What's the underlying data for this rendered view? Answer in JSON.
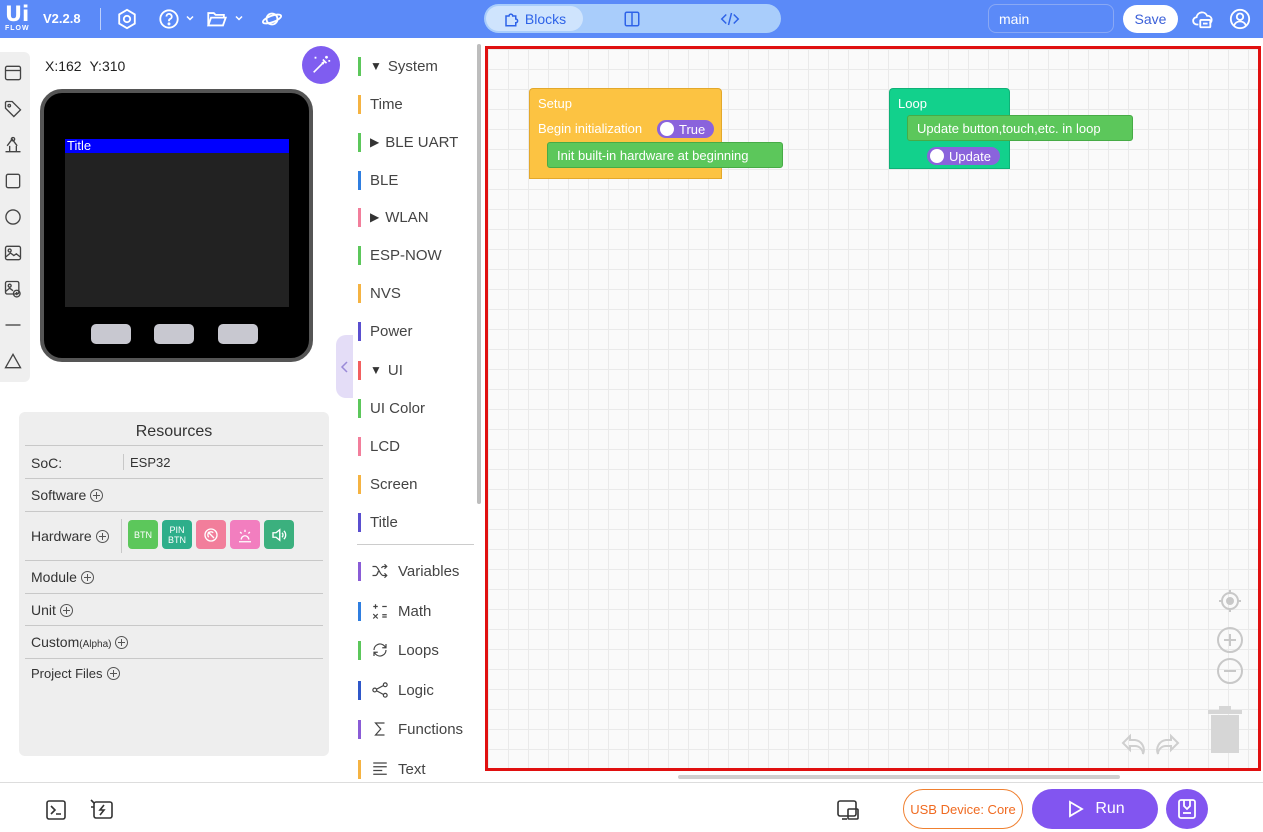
{
  "header": {
    "logo_main": "Ui",
    "logo_sub": "FLOW",
    "version": "V2.2.8",
    "views": [
      {
        "label": "Blocks",
        "icon": "puzzle-icon"
      },
      {
        "label": "",
        "icon": "split-view-icon"
      },
      {
        "label": "",
        "icon": "code-icon"
      }
    ],
    "branch": "main",
    "save_label": "Save"
  },
  "device": {
    "coords_x": "X:162",
    "coords_y": "Y:310",
    "screen_title": "Title",
    "screen_title_bg": "#0000ff"
  },
  "resources": {
    "title": "Resources",
    "soc_label": "SoC:",
    "soc_value": "ESP32",
    "software": "Software",
    "hardware": "Hardware",
    "hardware_items": [
      {
        "label": "BTN",
        "color": "#5cc75b"
      },
      {
        "label": "PIN BTN",
        "color": "#2dae8a"
      },
      {
        "label": "",
        "icon": "buzzer-icon",
        "color": "#f27e9b"
      },
      {
        "label": "",
        "icon": "light-icon",
        "color": "#f27ebf"
      },
      {
        "label": "",
        "icon": "speaker-icon",
        "color": "#3bb07e"
      }
    ],
    "module": "Module",
    "unit": "Unit",
    "custom": "Custom",
    "custom_tag": "(Alpha)",
    "project_files": "Project Files"
  },
  "categories": [
    {
      "label": "System",
      "color": "#5cc75b",
      "expanded": true
    },
    {
      "label": "Time",
      "color": "#f5b342"
    },
    {
      "label": "BLE UART",
      "color": "#5cc75b",
      "collapsed": true
    },
    {
      "label": "BLE",
      "color": "#2f7ee0"
    },
    {
      "label": "WLAN",
      "color": "#f27e9b",
      "collapsed": true
    },
    {
      "label": "ESP-NOW",
      "color": "#5cc75b"
    },
    {
      "label": "NVS",
      "color": "#f5b342"
    },
    {
      "label": "Power",
      "color": "#5a4fcf"
    },
    {
      "label": "UI",
      "color": "#f26060",
      "expanded": true
    },
    {
      "label": "UI Color",
      "color": "#5cc75b"
    },
    {
      "label": "LCD",
      "color": "#f27e9b"
    },
    {
      "label": "Screen",
      "color": "#f5b342"
    },
    {
      "label": "Title",
      "color": "#5a4fcf"
    }
  ],
  "core_categories": [
    {
      "label": "Variables",
      "color": "#8a5cd6",
      "icon": "shuffle-icon"
    },
    {
      "label": "Math",
      "color": "#2f7ee0",
      "icon": "math-icon"
    },
    {
      "label": "Loops",
      "color": "#5cc75b",
      "icon": "loop-icon"
    },
    {
      "label": "Logic",
      "color": "#2f57c9",
      "icon": "logic-icon"
    },
    {
      "label": "Functions",
      "color": "#8a5cd6",
      "icon": "sigma-icon"
    },
    {
      "label": "Text",
      "color": "#f5b342",
      "icon": "text-icon"
    }
  ],
  "workspace": {
    "setup": {
      "hat": "Setup",
      "begin_label": "Begin initialization",
      "begin_toggle": "True",
      "statement": "Init built-in hardware at beginning",
      "color": "#fcc342"
    },
    "loop": {
      "hat": "Loop",
      "statement": "Update button,touch,etc. in loop",
      "toggle": "Update",
      "color": "#12d18c"
    }
  },
  "footer": {
    "usb_device": "USB Device: Core",
    "run_label": "Run"
  }
}
